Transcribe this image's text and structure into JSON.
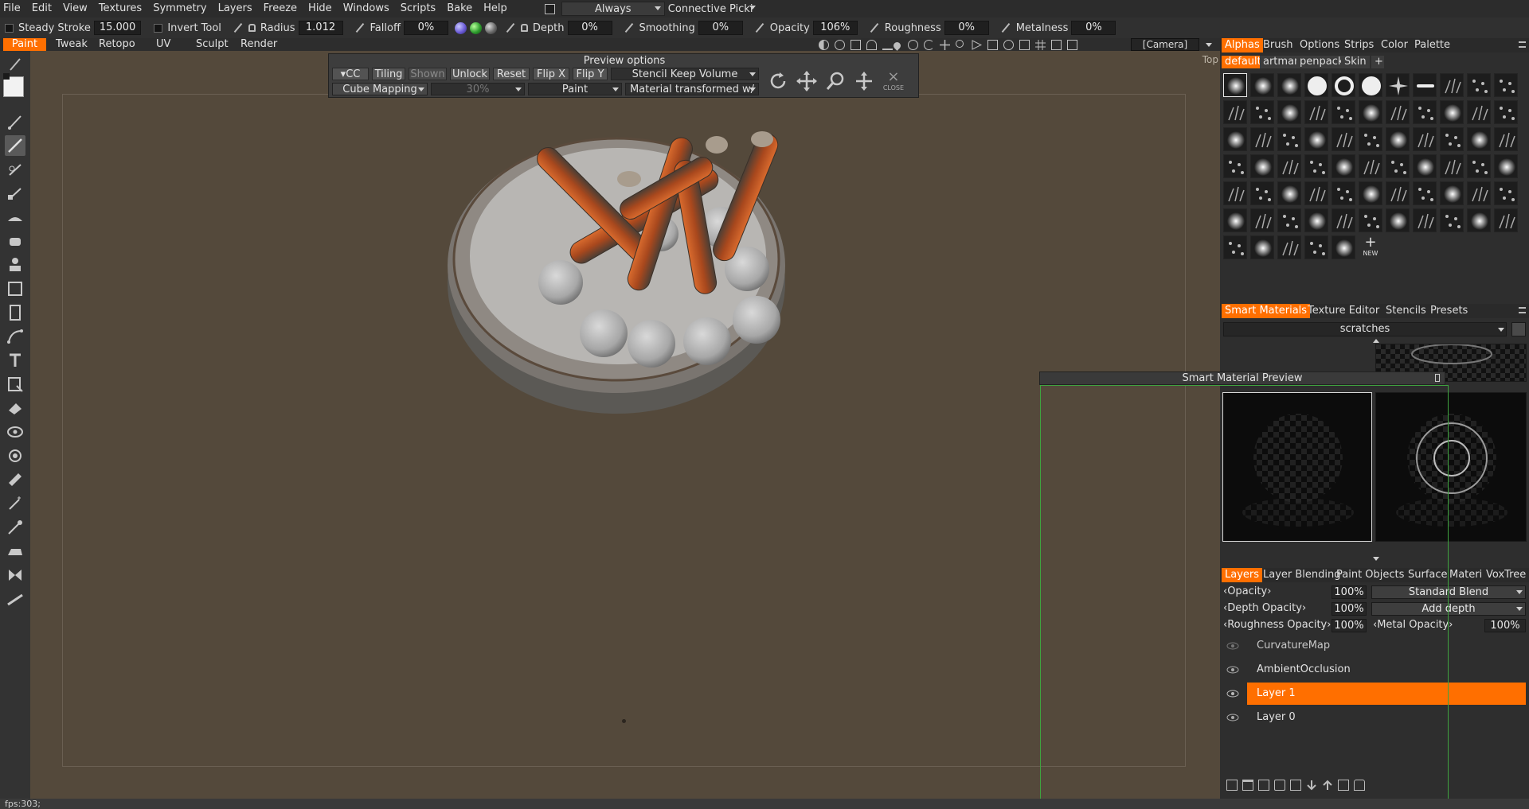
{
  "menu": [
    "File",
    "Edit",
    "View",
    "Textures",
    "Symmetry",
    "Layers",
    "Freeze",
    "Hide",
    "Windows",
    "Scripts",
    "Bake",
    "Help"
  ],
  "topbar": {
    "picking_mode": "Always",
    "connective_picking": "Connective Picki"
  },
  "toolbar": {
    "steady_stroke_label": "Steady Stroke",
    "steady_stroke_value": "15.000",
    "invert_tool_label": "Invert Tool",
    "radius_label": "Radius",
    "radius_value": "1.012",
    "falloff_label": "Falloff",
    "falloff_value": "0%",
    "depth_label": "Depth",
    "depth_value": "0%",
    "smoothing_label": "Smoothing",
    "smoothing_value": "0%",
    "opacity_label": "Opacity",
    "opacity_value": "106%",
    "roughness_label": "Roughness",
    "roughness_value": "0%",
    "metalness_label": "Metalness",
    "metalness_value": "0%"
  },
  "rooms": [
    "Paint",
    "Tweak",
    "Retopo",
    "UV",
    "Sculpt",
    "Render"
  ],
  "active_room": "Paint",
  "camera": "[Camera]",
  "viewport": {
    "view_label": "Top"
  },
  "preview_options": {
    "title": "Preview options",
    "cc": "CC",
    "tiling": "Tiling",
    "shown": "Shown",
    "unlock": "Unlock",
    "reset": "Reset",
    "flip_x": "Flip X",
    "flip_y": "Flip Y",
    "stencil_mode": "Stencil Keep Volume",
    "mapping": "Cube Mapping",
    "percent": "30%",
    "paint": "Paint",
    "material_mode": "Material transformed w/",
    "close": "CLOSE"
  },
  "alpha_panel": {
    "tabs": [
      "Alphas",
      "Brush",
      "Options",
      "Strips",
      "Color",
      "Palette"
    ],
    "active_tab": "Alphas",
    "subtabs": [
      "default",
      "artman",
      "penpack",
      "Skin"
    ],
    "active_subtab": "default",
    "new_label": "NEW"
  },
  "smart_materials": {
    "tabs": [
      "Smart Materials",
      "Texture Editor",
      "Stencils",
      "Presets"
    ],
    "active_tab": "Smart Materials",
    "search_value": "scratches",
    "preview_title": "Smart Material Preview"
  },
  "layers_panel": {
    "tabs": [
      "Layers",
      "Layer Blending",
      "Paint Objects",
      "Surface",
      "Materi",
      "VoxTree"
    ],
    "active_tab": "Layers",
    "opacity_label": "Opacity",
    "opacity_value": "100%",
    "blend_mode": "Standard Blend",
    "depth_opacity_label": "Depth Opacity",
    "depth_opacity_value": "100%",
    "depth_mode": "Add depth",
    "roughness_opacity_label": "Roughness Opacity",
    "roughness_opacity_value": "100%",
    "metal_opacity_label": "Metal Opacity",
    "metal_opacity_value": "100%",
    "layers": [
      {
        "name": "CurvatureMap",
        "active": false
      },
      {
        "name": "AmbientOcclusion",
        "active": false
      },
      {
        "name": "Layer 1",
        "active": true
      },
      {
        "name": "Layer 0",
        "active": false
      }
    ]
  },
  "status": {
    "fps": "fps:303;"
  },
  "colors": {
    "accent": "#ff6f00",
    "viewport_bg": "#54493b",
    "panel_bg": "#2e2e2e",
    "preview_frame": "#3fa33f"
  }
}
